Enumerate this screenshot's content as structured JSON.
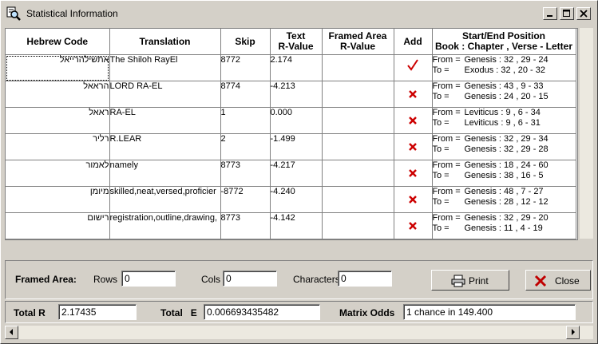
{
  "window": {
    "title": "Statistical Information"
  },
  "grid": {
    "headers": [
      {
        "line1": "Hebrew Code",
        "line2": ""
      },
      {
        "line1": "Translation",
        "line2": ""
      },
      {
        "line1": "Skip",
        "line2": ""
      },
      {
        "line1": "Text",
        "line2": "R-Value"
      },
      {
        "line1": "Framed Area",
        "line2": "R-Value"
      },
      {
        "line1": "Add",
        "line2": ""
      },
      {
        "line1": "Start/End Position",
        "line2": "Book : Chapter , Verse - Letter"
      }
    ],
    "rows": [
      {
        "hebrew": "אתשילהרייאל",
        "translation": "The Shiloh RayEl",
        "skip": "8772",
        "text_r": "2.174",
        "framed_r": "",
        "add": "check",
        "from_label": "From =",
        "from": "Genesis : 32 , 29 - 24",
        "to_label": "To =",
        "to": "Exodus : 32 , 20 - 32"
      },
      {
        "hebrew": "הראאל",
        "translation": "LORD RA-EL",
        "skip": "8774",
        "text_r": "-4.213",
        "framed_r": "",
        "add": "x",
        "from_label": "From =",
        "from": "Genesis : 43 , 9 - 33",
        "to_label": "To =",
        "to": "Genesis : 24 , 20 - 15"
      },
      {
        "hebrew": "ראאל",
        "translation": "RA-EL",
        "skip": "1",
        "text_r": "0.000",
        "framed_r": "",
        "add": "x",
        "from_label": "From =",
        "from": "Leviticus : 9 , 6 - 34",
        "to_label": "To =",
        "to": "Leviticus : 9 , 6 - 31"
      },
      {
        "hebrew": "רליר",
        "translation": "R.LEAR",
        "skip": "2",
        "text_r": "-1.499",
        "framed_r": "",
        "add": "x",
        "from_label": "From =",
        "from": "Genesis : 32 , 29 - 34",
        "to_label": "To =",
        "to": "Genesis : 32 , 29 - 28"
      },
      {
        "hebrew": "לאמור",
        "translation": "namely",
        "skip": "8773",
        "text_r": "-4.217",
        "framed_r": "",
        "add": "x",
        "from_label": "From =",
        "from": "Genesis : 18 , 24 - 60",
        "to_label": "To =",
        "to": "Genesis : 38 , 16 - 5"
      },
      {
        "hebrew": "מיומן",
        "translation": "skilled,neat,versed,proficier",
        "skip": "-8772",
        "text_r": "-4.240",
        "framed_r": "",
        "add": "x",
        "from_label": "From =",
        "from": "Genesis : 48 , 7 - 27",
        "to_label": "To =",
        "to": "Genesis : 28 , 12 - 12"
      },
      {
        "hebrew": "רישום",
        "translation": "registration,outline,drawing,",
        "skip": "8773",
        "text_r": "-4.142",
        "framed_r": "",
        "add": "x",
        "from_label": "From =",
        "from": "Genesis : 32 , 29 - 20",
        "to_label": "To =",
        "to": "Genesis : 11 , 4 - 19"
      }
    ]
  },
  "framed_area": {
    "label": "Framed Area:",
    "rows_label": "Rows",
    "rows_value": "0",
    "cols_label": "Cols",
    "cols_value": "0",
    "chars_label": "Characters",
    "chars_value": "0"
  },
  "buttons": {
    "print": "Print",
    "close": "Close"
  },
  "footer": {
    "total_r_label": "Total R",
    "total_r_value": "2.17435",
    "total_e_label": "Total   E",
    "total_e_value": "0.006693435482",
    "odds_label": "Matrix Odds",
    "odds_value": "1 chance in 149.400"
  },
  "colors": {
    "check": "#cc0000",
    "x": "#cc0000",
    "window_bg": "#d4d0c8"
  }
}
